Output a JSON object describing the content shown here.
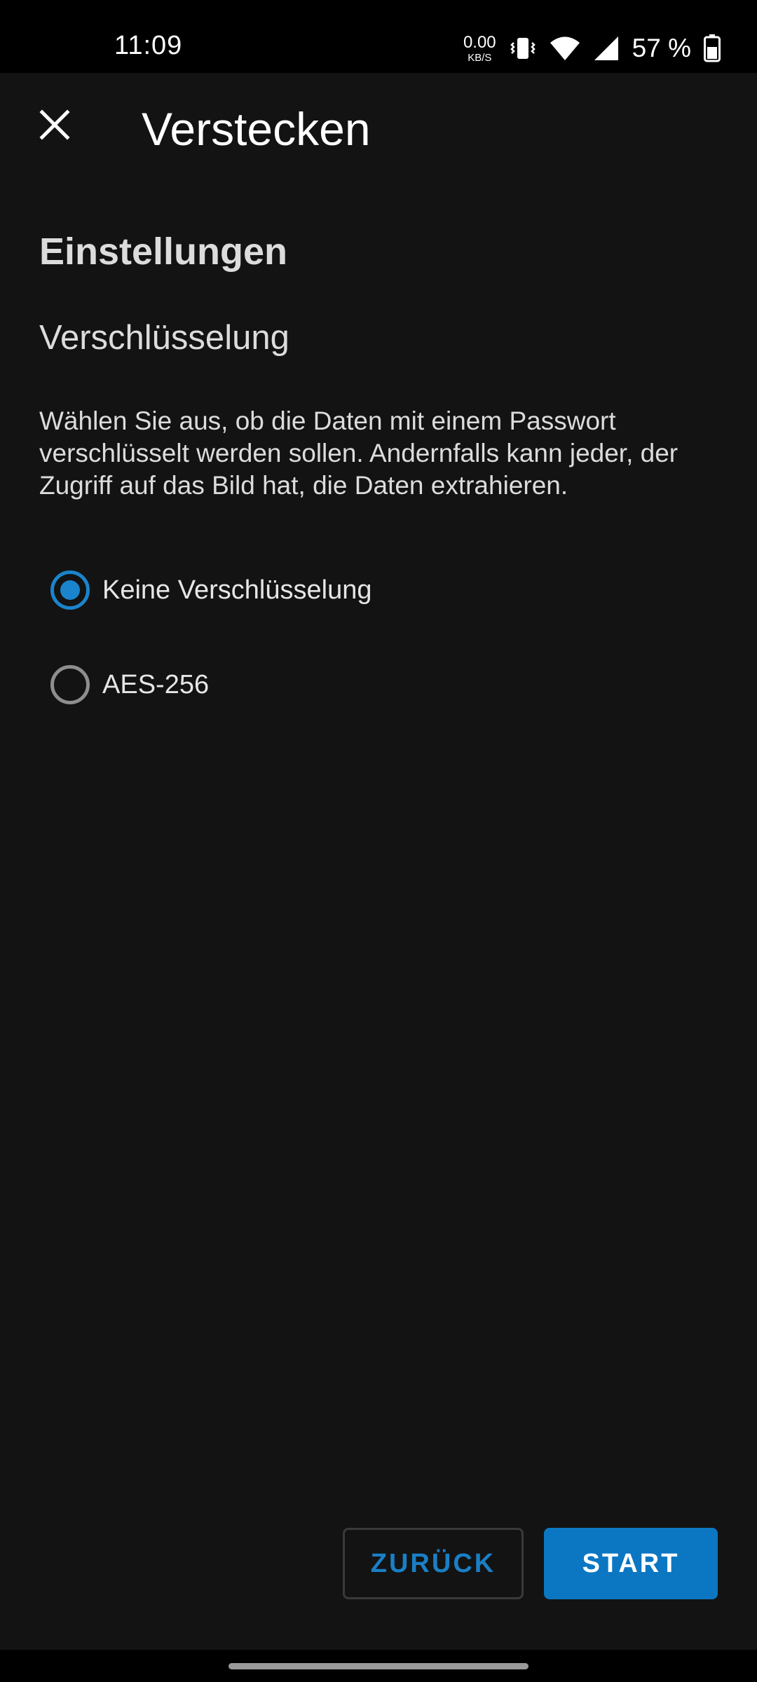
{
  "status_bar": {
    "time": "11:09",
    "net_speed_value": "0.00",
    "net_speed_unit": "KB/S",
    "battery_percent": "57 %",
    "icons": [
      "vibrate-icon",
      "wifi-icon",
      "cell-signal-icon",
      "battery-icon"
    ]
  },
  "toolbar": {
    "close_icon": "close-icon",
    "title": "Verstecken"
  },
  "content": {
    "section_title": "Einstellungen",
    "subsection_title": "Verschlüsselung",
    "description": "Wählen Sie aus, ob die Daten mit einem Passwort verschlüsselt werden sollen. Andernfalls kann jeder, der Zugriff auf das Bild hat, die Daten extrahieren.",
    "options": [
      {
        "label": "Keine Verschlüsselung",
        "selected": true
      },
      {
        "label": "AES-256",
        "selected": false
      }
    ]
  },
  "actions": {
    "back_label": "ZURÜCK",
    "start_label": "START"
  },
  "colors": {
    "accent": "#0b77c2",
    "background": "#131313"
  }
}
